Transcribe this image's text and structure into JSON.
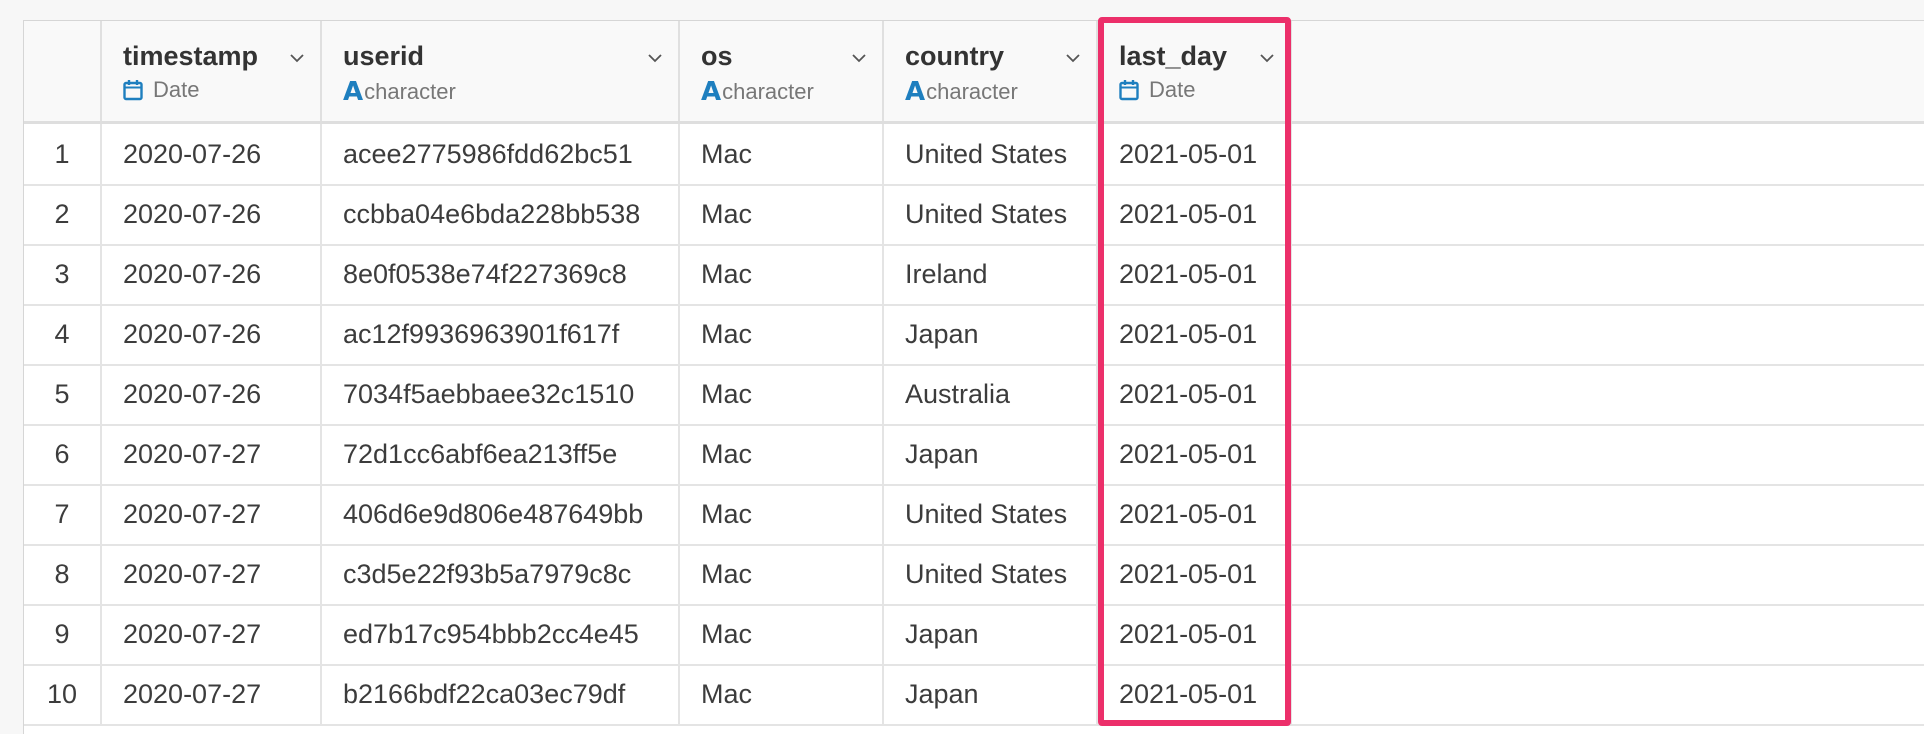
{
  "table": {
    "columns": [
      {
        "name": "timestamp",
        "type": "Date",
        "type_icon": "calendar-icon"
      },
      {
        "name": "userid",
        "type": "character",
        "type_icon": "character-type-icon"
      },
      {
        "name": "os",
        "type": "character",
        "type_icon": "character-type-icon"
      },
      {
        "name": "country",
        "type": "character",
        "type_icon": "character-type-icon"
      },
      {
        "name": "last_day",
        "type": "Date",
        "type_icon": "calendar-icon"
      }
    ],
    "character_icon_glyph": "A",
    "rows": [
      {
        "n": "1",
        "timestamp": "2020-07-26",
        "userid": "acee2775986fdd62bc51",
        "os": "Mac",
        "country": "United States",
        "last_day": "2021-05-01"
      },
      {
        "n": "2",
        "timestamp": "2020-07-26",
        "userid": "ccbba04e6bda228bb538",
        "os": "Mac",
        "country": "United States",
        "last_day": "2021-05-01"
      },
      {
        "n": "3",
        "timestamp": "2020-07-26",
        "userid": "8e0f0538e74f227369c8",
        "os": "Mac",
        "country": "Ireland",
        "last_day": "2021-05-01"
      },
      {
        "n": "4",
        "timestamp": "2020-07-26",
        "userid": "ac12f9936963901f617f",
        "os": "Mac",
        "country": "Japan",
        "last_day": "2021-05-01"
      },
      {
        "n": "5",
        "timestamp": "2020-07-26",
        "userid": "7034f5aebbaee32c1510",
        "os": "Mac",
        "country": "Australia",
        "last_day": "2021-05-01"
      },
      {
        "n": "6",
        "timestamp": "2020-07-27",
        "userid": "72d1cc6abf6ea213ff5e",
        "os": "Mac",
        "country": "Japan",
        "last_day": "2021-05-01"
      },
      {
        "n": "7",
        "timestamp": "2020-07-27",
        "userid": "406d6e9d806e487649bb",
        "os": "Mac",
        "country": "United States",
        "last_day": "2021-05-01"
      },
      {
        "n": "8",
        "timestamp": "2020-07-27",
        "userid": "c3d5e22f93b5a7979c8c",
        "os": "Mac",
        "country": "United States",
        "last_day": "2021-05-01"
      },
      {
        "n": "9",
        "timestamp": "2020-07-27",
        "userid": "ed7b17c954bbb2cc4e45",
        "os": "Mac",
        "country": "Japan",
        "last_day": "2021-05-01"
      },
      {
        "n": "10",
        "timestamp": "2020-07-27",
        "userid": "b2166bdf22ca03ec79df",
        "os": "Mac",
        "country": "Japan",
        "last_day": "2021-05-01"
      }
    ],
    "highlighted_column": "last_day"
  },
  "colors": {
    "highlight": "#ec2f6a",
    "type_icon": "#1e7fbf",
    "background": "#f7f7f7"
  }
}
